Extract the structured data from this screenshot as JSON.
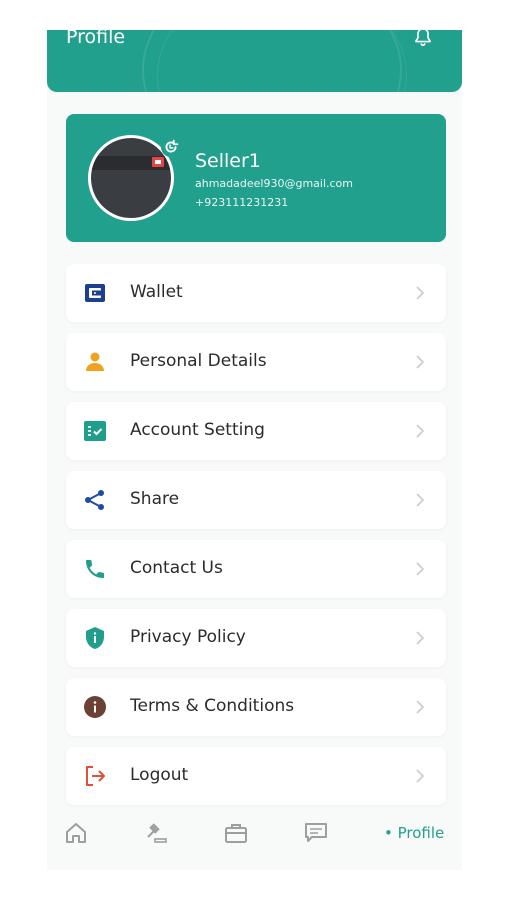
{
  "header": {
    "title": "Profile",
    "bell_icon": "bell-icon"
  },
  "profile": {
    "name": "Seller1",
    "email": "ahmadadeel930@gmail.com",
    "phone": "+923111231231",
    "edit_icon": "refresh-edit-icon"
  },
  "menu": {
    "items": [
      {
        "label": "Wallet",
        "icon": "wallet-icon",
        "color": "#1d3f8f"
      },
      {
        "label": "Personal Details",
        "icon": "person-icon",
        "color": "#f0a21c"
      },
      {
        "label": "Account Setting",
        "icon": "settings-list-icon",
        "color": "#1f9e8c"
      },
      {
        "label": "Share",
        "icon": "share-icon",
        "color": "#1f4aa8"
      },
      {
        "label": "Contact Us",
        "icon": "phone-icon",
        "color": "#1f9e8c"
      },
      {
        "label": "Privacy Policy",
        "icon": "shield-icon",
        "color": "#1f9e8c"
      },
      {
        "label": "Terms & Conditions",
        "icon": "info-icon",
        "color": "#6a4134"
      },
      {
        "label": "Logout",
        "icon": "logout-icon",
        "color": "#e0503f"
      }
    ]
  },
  "bottom_nav": {
    "items": [
      {
        "icon": "home-icon"
      },
      {
        "icon": "auction-gavel-icon"
      },
      {
        "icon": "briefcase-icon"
      },
      {
        "icon": "chat-icon"
      }
    ],
    "active_label": "• Profile"
  },
  "colors": {
    "brand": "#22a08e",
    "background": "#f8f9f9",
    "text": "#2b2b2b"
  }
}
